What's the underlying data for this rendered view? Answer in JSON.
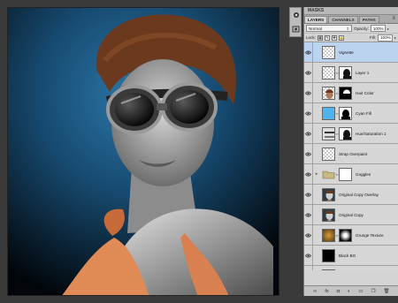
{
  "panel": {
    "top_tab": "MASKS",
    "tabs": [
      {
        "label": "LAYERS",
        "active": true
      },
      {
        "label": "CHANNELS",
        "active": false
      },
      {
        "label": "PATHS",
        "active": false
      }
    ],
    "menu_icon": "panel-menu-icon",
    "blend_mode": "Normal",
    "opacity_label": "Opacity:",
    "opacity_value": "100%",
    "lock_label": "Lock:",
    "fill_label": "Fill:",
    "fill_value": "100%"
  },
  "layers": [
    {
      "name": "Vignette",
      "selected": true,
      "thumb": "checker",
      "mask": "none",
      "group": false
    },
    {
      "name": "Layer 1",
      "selected": false,
      "thumb": "checker",
      "mask": "dark-figure",
      "group": false
    },
    {
      "name": "Hair Color",
      "selected": false,
      "thumb": "checker-face",
      "mask": "white-figure",
      "group": false
    },
    {
      "name": "Cyan Fill",
      "selected": false,
      "thumb": "cyan",
      "mask": "black-figure",
      "group": false
    },
    {
      "name": "Hue/Saturation 1",
      "selected": false,
      "thumb": "adjust",
      "mask": "dark-figure",
      "group": false
    },
    {
      "name": "Strap Overpaint",
      "selected": false,
      "thumb": "checker",
      "mask": "none",
      "group": false
    },
    {
      "name": "Goggles",
      "selected": false,
      "thumb": "folder",
      "mask": "white",
      "group": true
    },
    {
      "name": "Original Copy Overlay",
      "selected": false,
      "thumb": "portrait",
      "mask": "none",
      "group": false
    },
    {
      "name": "Original Copy",
      "selected": false,
      "thumb": "portrait",
      "mask": "none",
      "group": false
    },
    {
      "name": "Grunge Texture",
      "selected": false,
      "thumb": "grunge",
      "mask": "radial",
      "group": false
    },
    {
      "name": "Black BG",
      "selected": false,
      "thumb": "black",
      "mask": "none",
      "group": false
    },
    {
      "name": "Original",
      "selected": false,
      "thumb": "portrait-color",
      "mask": "none",
      "group": false
    }
  ],
  "footer_icons": [
    "link-icon",
    "fx-icon",
    "add-mask-icon",
    "adjustment-icon",
    "new-group-icon",
    "new-layer-icon",
    "trash-icon"
  ],
  "footer_glyphs": [
    "∞",
    "fx",
    "◘",
    "◐",
    "▭",
    "❐",
    "🗑"
  ],
  "colors": {
    "selected_layer": "#bcd3f0",
    "cyan_fill": "#4fb3f0",
    "backdrop_blue": "#1c5a86",
    "hair": "#6b3a1e",
    "top_orange": "#e08a55"
  }
}
